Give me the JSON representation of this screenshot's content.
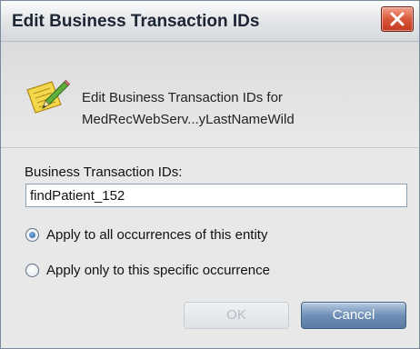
{
  "dialog": {
    "title": "Edit Business Transaction IDs",
    "close_icon": "close-icon"
  },
  "info": {
    "icon": "edit-pencil-icon",
    "line1": "Edit Business Transaction IDs for",
    "line2": "MedRecWebServ...yLastNameWild"
  },
  "form": {
    "label": "Business Transaction IDs:",
    "value": "findPatient_152"
  },
  "scope": {
    "options": [
      {
        "label": "Apply to all occurrences of this entity",
        "selected": true
      },
      {
        "label": "Apply only to this specific occurrence",
        "selected": false
      }
    ]
  },
  "buttons": {
    "ok": "OK",
    "cancel": "Cancel",
    "ok_enabled": false
  },
  "colors": {
    "close_button": "#d9573b",
    "primary_button": "#6f8fb6",
    "dialog_background": "#e8e8e8"
  }
}
